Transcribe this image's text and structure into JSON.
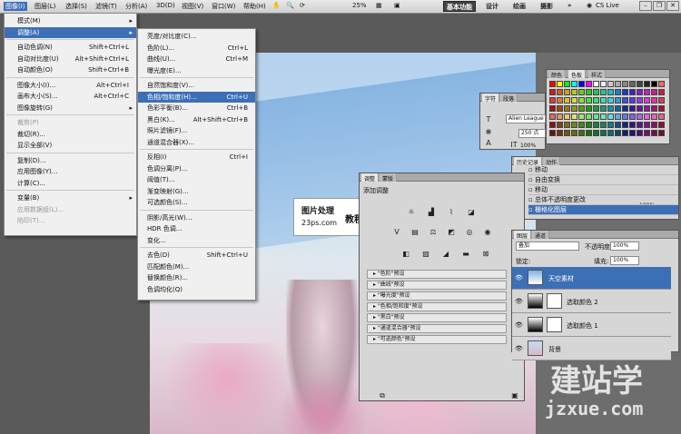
{
  "menubar": {
    "items": [
      "图像(I)",
      "图层(L)",
      "选择(S)",
      "滤镜(T)",
      "分析(A)",
      "3D(D)",
      "视图(V)",
      "窗口(W)",
      "帮助(H)"
    ],
    "zoom": "25%",
    "workspaces": [
      "基本功能",
      "设计",
      "绘画",
      "摄影"
    ],
    "more": "»",
    "cslive": "CS Live"
  },
  "image_menu": {
    "items": [
      {
        "label": "模式(M)",
        "shortcut": "",
        "sub": true
      },
      {
        "label": "调整(A)",
        "shortcut": "",
        "sub": true,
        "hl": true
      },
      {
        "label": "自动色调(N)",
        "shortcut": "Shift+Ctrl+L"
      },
      {
        "label": "自动对比度(U)",
        "shortcut": "Alt+Shift+Ctrl+L"
      },
      {
        "label": "自动颜色(O)",
        "shortcut": "Shift+Ctrl+B"
      },
      {
        "label": "图像大小(I)...",
        "shortcut": "Alt+Ctrl+I"
      },
      {
        "label": "画布大小(S)...",
        "shortcut": "Alt+Ctrl+C"
      },
      {
        "label": "图像旋转(G)",
        "shortcut": "",
        "sub": true
      },
      {
        "label": "裁剪(P)",
        "shortcut": "",
        "dis": true
      },
      {
        "label": "裁切(R)...",
        "shortcut": ""
      },
      {
        "label": "显示全部(V)",
        "shortcut": ""
      },
      {
        "label": "复制(D)...",
        "shortcut": ""
      },
      {
        "label": "应用图像(Y)...",
        "shortcut": ""
      },
      {
        "label": "计算(C)...",
        "shortcut": ""
      },
      {
        "label": "变量(B)",
        "shortcut": "",
        "sub": true
      },
      {
        "label": "应用数据组(L)...",
        "shortcut": "",
        "dis": true
      },
      {
        "label": "陷印(T)...",
        "shortcut": "",
        "dis": true
      }
    ]
  },
  "adjust_menu": {
    "items": [
      {
        "label": "亮度/对比度(C)...",
        "shortcut": ""
      },
      {
        "label": "色阶(L)...",
        "shortcut": "Ctrl+L"
      },
      {
        "label": "曲线(U)...",
        "shortcut": "Ctrl+M"
      },
      {
        "label": "曝光度(E)...",
        "shortcut": ""
      },
      {
        "label": "自然饱和度(V)...",
        "shortcut": ""
      },
      {
        "label": "色相/饱和度(H)...",
        "shortcut": "Ctrl+U",
        "hl": true
      },
      {
        "label": "色彩平衡(B)...",
        "shortcut": "Ctrl+B"
      },
      {
        "label": "黑白(K)...",
        "shortcut": "Alt+Shift+Ctrl+B"
      },
      {
        "label": "照片滤镜(F)...",
        "shortcut": ""
      },
      {
        "label": "通道混合器(X)...",
        "shortcut": ""
      },
      {
        "label": "反相(I)",
        "shortcut": "Ctrl+I"
      },
      {
        "label": "色调分离(P)...",
        "shortcut": ""
      },
      {
        "label": "阈值(T)...",
        "shortcut": ""
      },
      {
        "label": "渐变映射(G)...",
        "shortcut": ""
      },
      {
        "label": "可选颜色(S)...",
        "shortcut": ""
      },
      {
        "label": "阴影/高光(W)...",
        "shortcut": ""
      },
      {
        "label": "HDR 色调...",
        "shortcut": ""
      },
      {
        "label": "变化...",
        "shortcut": ""
      },
      {
        "label": "去色(D)",
        "shortcut": "Shift+Ctrl+U"
      },
      {
        "label": "匹配颜色(M)...",
        "shortcut": ""
      },
      {
        "label": "替换颜色(R)...",
        "shortcut": ""
      },
      {
        "label": "色调均化(Q)",
        "shortcut": ""
      }
    ]
  },
  "watermark": {
    "line1": "图片处理",
    "line2": "教程网",
    "line3": "23ps.com"
  },
  "swatches_panel": {
    "tabs": [
      "颜色",
      "色板",
      "样式"
    ]
  },
  "char_panel": {
    "tabs": [
      "字符",
      "段落"
    ],
    "font": "Alien League",
    "size": "250 点",
    "pct1": "100%",
    "pct2": "100%"
  },
  "history_panel": {
    "tabs": [
      "历史记录",
      "动作"
    ],
    "items": [
      "移动",
      "自由变换",
      "移动",
      "总体不透明度更改",
      "栅格化图层"
    ],
    "selected": 4
  },
  "adjust_panel": {
    "tabs": [
      "调整",
      "蒙版"
    ],
    "title": "添加调整",
    "presets": [
      "\"色阶\"预设",
      "\"曲线\"预设",
      "\"曝光度\"预设",
      "\"色相/饱和度\"预设",
      "\"黑白\"预设",
      "\"通道混合器\"预设",
      "\"可选颜色\"预设"
    ]
  },
  "layers_panel": {
    "tabs": [
      "图层",
      "通道"
    ],
    "blend": "叠加",
    "opacity_label": "不透明度:",
    "opacity": "100%",
    "lock_label": "锁定:",
    "fill_label": "填充:",
    "fill": "100%",
    "layers": [
      "天空素材",
      "选取颜色 2",
      "选取颜色 1",
      "背景"
    ]
  },
  "brand": {
    "cn": "建站学",
    "url": "jzxue.com"
  }
}
